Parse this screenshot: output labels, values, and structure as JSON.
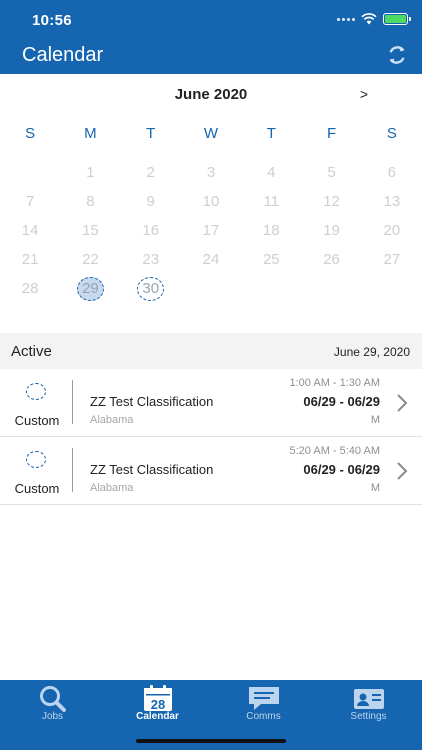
{
  "status": {
    "time": "10:56"
  },
  "header": {
    "title": "Calendar"
  },
  "calendar": {
    "month_title": "June 2020",
    "next_label": ">",
    "weekdays": [
      "S",
      "M",
      "T",
      "W",
      "T",
      "F",
      "S"
    ],
    "days": [
      "",
      "1",
      "2",
      "3",
      "4",
      "5",
      "6",
      "7",
      "8",
      "9",
      "10",
      "11",
      "12",
      "13",
      "14",
      "15",
      "16",
      "17",
      "18",
      "19",
      "20",
      "21",
      "22",
      "23",
      "24",
      "25",
      "26",
      "27",
      "28",
      "29",
      "30",
      "",
      "",
      "",
      ""
    ],
    "selected_day": "29",
    "outlined_day": "30"
  },
  "active": {
    "label": "Active",
    "date": "June 29, 2020",
    "jobs": [
      {
        "type": "Custom",
        "title": "ZZ Test Classification",
        "location": "Alabama",
        "time": "1:00 AM - 1:30 AM",
        "dates": "06/29 - 06/29",
        "code": "M"
      },
      {
        "type": "Custom",
        "title": "ZZ Test Classification",
        "location": "Alabama",
        "time": "5:20 AM - 5:40 AM",
        "dates": "06/29 - 06/29",
        "code": "M"
      }
    ]
  },
  "tabbar": {
    "tabs": [
      {
        "label": "Jobs",
        "icon": "search-icon"
      },
      {
        "label": "Calendar",
        "icon": "calendar-icon",
        "badge": "28"
      },
      {
        "label": "Comms",
        "icon": "chat-icon"
      },
      {
        "label": "Settings",
        "icon": "id-card-icon"
      }
    ],
    "active_tab": "Calendar"
  },
  "colors": {
    "brand": "#1565b0",
    "selected_fill": "#c7d9ef"
  }
}
